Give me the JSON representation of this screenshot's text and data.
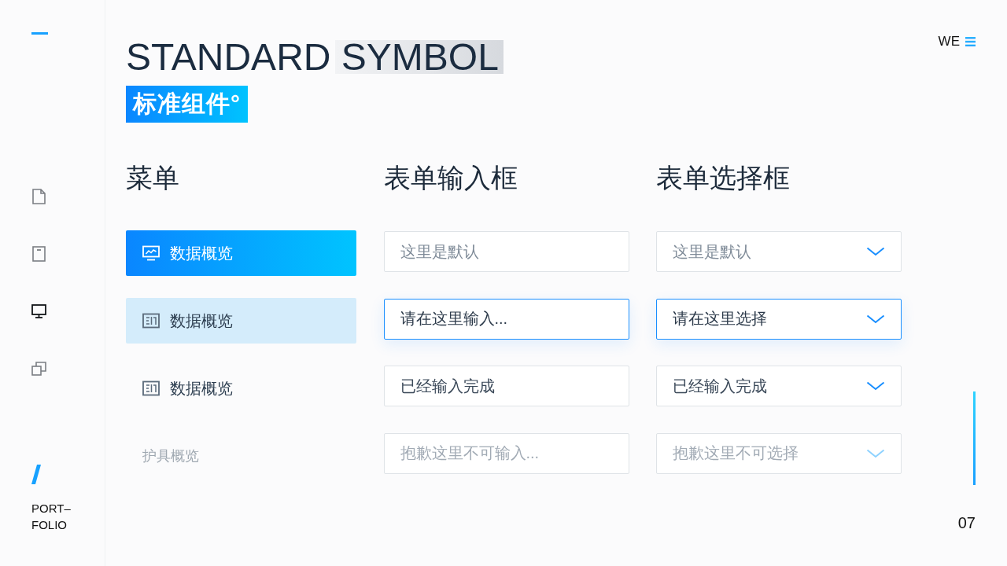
{
  "rail": {
    "items": [
      {
        "kind": "document",
        "selected": false
      },
      {
        "kind": "clipboard",
        "selected": false
      },
      {
        "kind": "monitor",
        "selected": true
      },
      {
        "kind": "copy",
        "selected": false
      }
    ],
    "footer_lines": [
      "PORT–",
      "FOLIO"
    ]
  },
  "header": {
    "title": "STANDARD SYMBOL",
    "subtitle": "标准组件°"
  },
  "top_right": {
    "label": "WE"
  },
  "menu": {
    "heading": "菜单",
    "items": [
      {
        "label": "数据概览",
        "kind": "chart",
        "selected": true,
        "hovered": false,
        "disabled": false
      },
      {
        "label": "数据概览",
        "kind": "panel",
        "selected": false,
        "hovered": true,
        "disabled": false
      },
      {
        "label": "数据概览",
        "kind": "panel",
        "selected": false,
        "hovered": false,
        "disabled": false
      },
      {
        "label": "护具概览",
        "kind": "plain",
        "selected": false,
        "hovered": false,
        "disabled": true
      }
    ]
  },
  "text_inputs": {
    "heading": "表单输入框",
    "fields": [
      {
        "placeholder": "这里是默认",
        "focused": false,
        "disabled": false
      },
      {
        "placeholder": "请在这里输入...",
        "focused": true,
        "disabled": false
      },
      {
        "value": "已经输入完成",
        "focused": false,
        "disabled": false
      },
      {
        "placeholder": "抱歉这里不可输入...",
        "focused": false,
        "disabled": true
      }
    ]
  },
  "selects": {
    "heading": "表单选择框",
    "fields": [
      {
        "placeholder": "这里是默认",
        "focused": false,
        "disabled": false
      },
      {
        "placeholder": "请在这里选择",
        "focused": true,
        "disabled": false
      },
      {
        "value": "已经输入完成",
        "focused": false,
        "disabled": false
      },
      {
        "placeholder": "抱歉这里不可选择",
        "focused": false,
        "disabled": true
      }
    ]
  },
  "page_number": "07"
}
